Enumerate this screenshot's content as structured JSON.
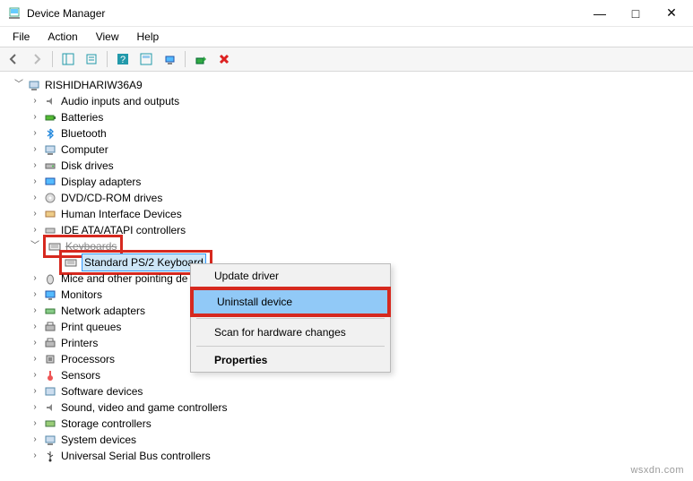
{
  "window": {
    "title": "Device Manager"
  },
  "menus": {
    "file": "File",
    "action": "Action",
    "view": "View",
    "help": "Help"
  },
  "tree": {
    "root": "RISHIDHARIW36A9",
    "items": [
      {
        "label": "Audio inputs and outputs",
        "expanded": false
      },
      {
        "label": "Batteries",
        "expanded": false
      },
      {
        "label": "Bluetooth",
        "expanded": false
      },
      {
        "label": "Computer",
        "expanded": false
      },
      {
        "label": "Disk drives",
        "expanded": false
      },
      {
        "label": "Display adapters",
        "expanded": false
      },
      {
        "label": "DVD/CD-ROM drives",
        "expanded": false
      },
      {
        "label": "Human Interface Devices",
        "expanded": false
      },
      {
        "label": "IDE ATA/ATAPI controllers",
        "expanded": false
      },
      {
        "label": "Keyboards",
        "expanded": true,
        "children": [
          {
            "label": "Standard PS/2 Keyboard",
            "selected": true
          }
        ]
      },
      {
        "label": "Mice and other pointing de",
        "expanded": false
      },
      {
        "label": "Monitors",
        "expanded": false
      },
      {
        "label": "Network adapters",
        "expanded": false
      },
      {
        "label": "Print queues",
        "expanded": false
      },
      {
        "label": "Printers",
        "expanded": false
      },
      {
        "label": "Processors",
        "expanded": false
      },
      {
        "label": "Sensors",
        "expanded": false
      },
      {
        "label": "Software devices",
        "expanded": false
      },
      {
        "label": "Sound, video and game controllers",
        "expanded": false
      },
      {
        "label": "Storage controllers",
        "expanded": false
      },
      {
        "label": "System devices",
        "expanded": false
      },
      {
        "label": "Universal Serial Bus controllers",
        "expanded": false
      }
    ]
  },
  "context_menu": {
    "update": "Update driver",
    "uninstall": "Uninstall device",
    "scan": "Scan for hardware changes",
    "properties": "Properties"
  },
  "watermark": "wsxdn.com"
}
